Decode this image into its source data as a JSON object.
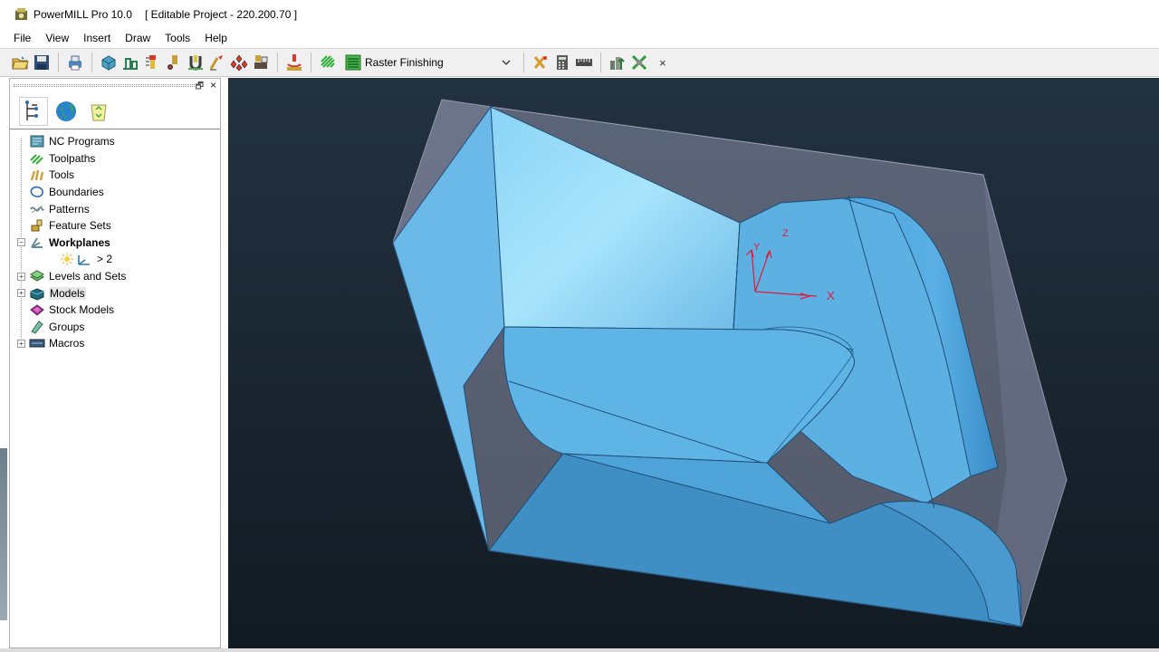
{
  "window": {
    "title": "PowerMILL Pro 10.0",
    "project": "[ Editable Project - 220.200.70 ]"
  },
  "menu": [
    "File",
    "View",
    "Insert",
    "Draw",
    "Tools",
    "Help"
  ],
  "toolbar": {
    "strategy": "Raster Finishing",
    "close_glyph": "×",
    "icons": [
      "open-project-icon",
      "save-project-icon",
      "print-icon",
      "block-icon",
      "rapid-move-heights-icon",
      "tool-icon",
      "start-point-icon",
      "feed-rates-icon",
      "leads-links-icon",
      "toolpath-verify-icon",
      "simulation-icon",
      "raster-strategy-icon",
      "tool-database-icon",
      "calculator-icon",
      "ruler-icon",
      "workplane-icon",
      "transform-icon"
    ]
  },
  "explorer": {
    "restore_glyph": "🗗",
    "close_glyph": "×",
    "tabs": [
      "explorer-tree-tab",
      "world-tab",
      "recycle-bin-tab"
    ],
    "items": [
      {
        "label": "NC Programs",
        "icon": "nc-programs-icon",
        "expander": ""
      },
      {
        "label": "Toolpaths",
        "icon": "toolpaths-icon",
        "expander": ""
      },
      {
        "label": "Tools",
        "icon": "tools-icon",
        "expander": ""
      },
      {
        "label": "Boundaries",
        "icon": "boundaries-icon",
        "expander": ""
      },
      {
        "label": "Patterns",
        "icon": "patterns-icon",
        "expander": ""
      },
      {
        "label": "Feature Sets",
        "icon": "feature-sets-icon",
        "expander": ""
      },
      {
        "label": "Workplanes",
        "icon": "workplanes-icon",
        "expander": "−",
        "bold": true
      },
      {
        "label": "> 2",
        "icon": "active-workplane-icon",
        "child": true
      },
      {
        "label": "Levels and Sets",
        "icon": "levels-icon",
        "expander": "+"
      },
      {
        "label": "Models",
        "icon": "models-icon",
        "expander": "+",
        "selected": true
      },
      {
        "label": "Stock Models",
        "icon": "stock-models-icon",
        "expander": ""
      },
      {
        "label": "Groups",
        "icon": "groups-icon",
        "expander": ""
      },
      {
        "label": "Macros",
        "icon": "macros-icon",
        "expander": "+"
      }
    ]
  },
  "viewport": {
    "axis_x": "X",
    "axis_y": "Y",
    "axis_z": "Z",
    "model_color": "#5aaee0",
    "block_color": "#8a8fa6"
  }
}
